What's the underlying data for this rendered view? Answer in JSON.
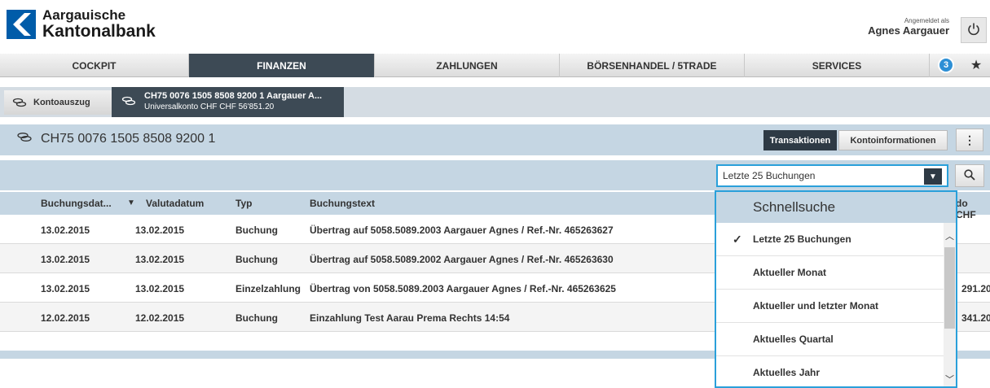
{
  "header": {
    "logo_line1": "Aargauische",
    "logo_line2": "Kantonalbank",
    "logged_in_label": "Angemeldet als",
    "user_name": "Agnes Aargauer"
  },
  "nav": {
    "items": [
      {
        "label": "COCKPIT",
        "active": false
      },
      {
        "label": "FINANZEN",
        "active": true
      },
      {
        "label": "ZAHLUNGEN",
        "active": false
      },
      {
        "label": "BÖRSENHANDEL / 5TRADE",
        "active": false
      },
      {
        "label": "SERVICES",
        "active": false
      }
    ],
    "badge_count": "3"
  },
  "breadcrumb": {
    "first": "Kontoauszug",
    "second_title": "CH75 0076 1505 8508 9200 1 Aargauer A...",
    "second_sub": "Universalkonto CHF CHF 56'851.20"
  },
  "account": {
    "iban": "CH75 0076 1505 8508 9200 1",
    "tab_transactions": "Transaktionen",
    "tab_info": "Kontoinformationen",
    "more": "⋮"
  },
  "filter": {
    "selected": "Letzte 25 Buchungen"
  },
  "table": {
    "headers": {
      "booking_date": "Buchungsdat...",
      "sort_indicator": "▼",
      "value_date": "Valutadatum",
      "type": "Typ",
      "text": "Buchungstext",
      "balance": "do CHF"
    },
    "rows": [
      {
        "booking_date": "13.02.2015",
        "value_date": "13.02.2015",
        "type": "Buchung",
        "text": "Übertrag auf 5058.5089.2003 Aargauer Agnes / Ref.-Nr. 465263627",
        "balance": ""
      },
      {
        "booking_date": "13.02.2015",
        "value_date": "13.02.2015",
        "type": "Buchung",
        "text": "Übertrag auf 5058.5089.2002 Aargauer Agnes / Ref.-Nr. 465263630",
        "balance": ""
      },
      {
        "booking_date": "13.02.2015",
        "value_date": "13.02.2015",
        "type": "Einzelzahlung",
        "text": "Übertrag von 5058.5089.2003 Aargauer Agnes / Ref.-Nr. 465263625",
        "balance": "291.20"
      },
      {
        "booking_date": "12.02.2015",
        "value_date": "12.02.2015",
        "type": "Buchung",
        "text": "Einzahlung Test Aarau Prema Rechts 14:54",
        "balance": "341.20"
      }
    ]
  },
  "dropdown": {
    "title": "Schnellsuche",
    "items": [
      {
        "label": "Letzte 25 Buchungen",
        "checked": true
      },
      {
        "label": "Aktueller Monat",
        "checked": false
      },
      {
        "label": "Aktueller und letzter Monat",
        "checked": false
      },
      {
        "label": "Aktuelles Quartal",
        "checked": false
      },
      {
        "label": "Aktuelles Jahr",
        "checked": false
      }
    ]
  },
  "colors": {
    "brand_blue": "#005ca9",
    "active_nav": "#3d4a55",
    "light_blue_bar": "#c5d6e3",
    "focus_blue": "#2aa0da",
    "badge_blue": "#2d8fd5"
  },
  "icons": {
    "power": "power-icon",
    "star": "star-icon",
    "account": "coins-icon",
    "search": "search-icon",
    "check": "checkmark-icon"
  }
}
